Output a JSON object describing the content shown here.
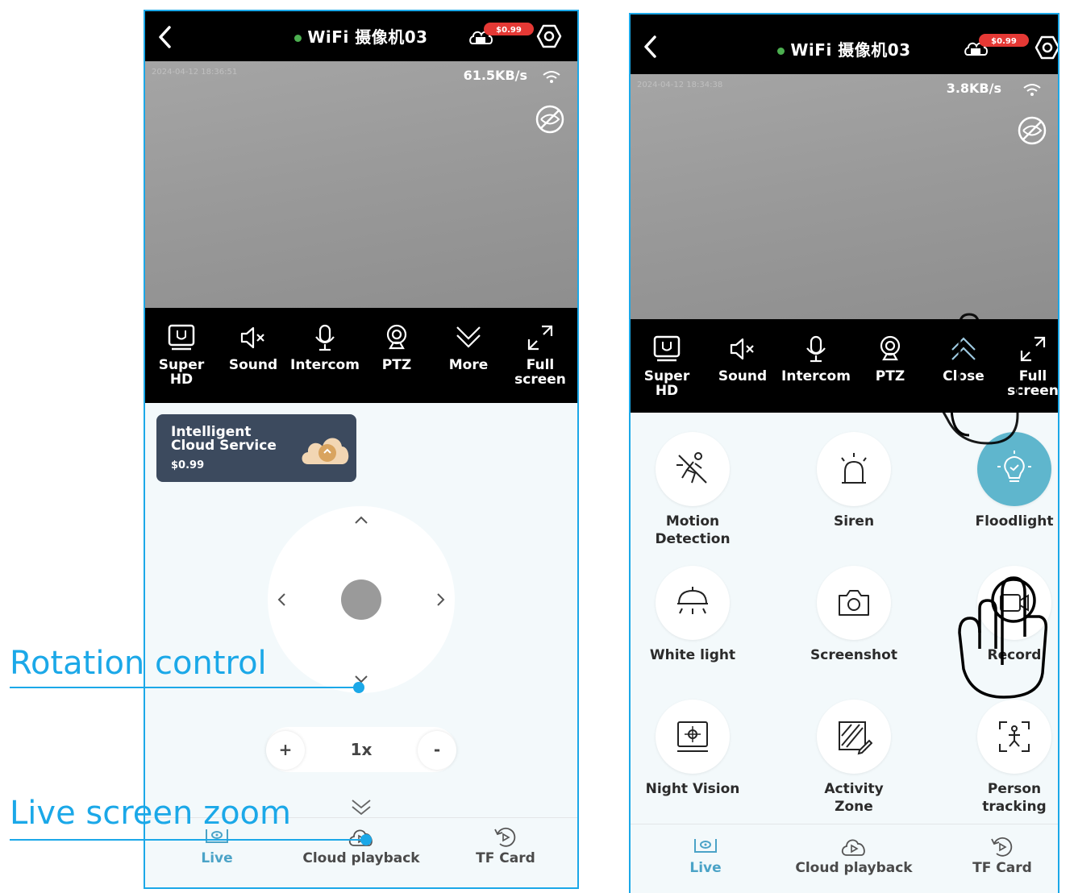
{
  "colors": {
    "accent": "#1ba8e8",
    "online": "#4caf50",
    "price_badge": "#e53935",
    "floodlight_on": "#5fb6cd",
    "nav_active": "#4ba3c7"
  },
  "left": {
    "header": {
      "back_icon": "chevron-left-icon",
      "title": "WiFi 摄像机03",
      "cloud_price": "$0.99"
    },
    "video": {
      "timestamp": "2024-04-12 18:36:51",
      "speed": "61.5KB/s"
    },
    "toolbar": [
      {
        "label": "Super HD",
        "icon": "hd-icon"
      },
      {
        "label": "Sound",
        "icon": "speaker-mute-icon"
      },
      {
        "label": "Intercom",
        "icon": "microphone-icon"
      },
      {
        "label": "PTZ",
        "icon": "camera-icon"
      },
      {
        "label": "More",
        "icon": "chevron-double-down-icon"
      },
      {
        "label": "Full screen",
        "icon": "expand-icon"
      }
    ],
    "promo": {
      "title": "Intelligent Cloud Service",
      "price": "$0.99"
    },
    "zoom": {
      "plus": "+",
      "value": "1x",
      "minus": "-"
    },
    "nav": [
      {
        "label": "Live",
        "icon": "live-icon",
        "active": true
      },
      {
        "label": "Cloud playback",
        "icon": "cloud-play-icon",
        "active": false
      },
      {
        "label": "TF Card",
        "icon": "tf-card-icon",
        "active": false
      }
    ]
  },
  "right": {
    "header": {
      "title": "WiFi 摄像机03",
      "cloud_price": "$0.99"
    },
    "video": {
      "timestamp": "2024-04-12 18:34:38",
      "speed": "3.8KB/s"
    },
    "toolbar": [
      {
        "label": "Super HD",
        "icon": "hd-icon"
      },
      {
        "label": "Sound",
        "icon": "speaker-mute-icon"
      },
      {
        "label": "Intercom",
        "icon": "microphone-icon"
      },
      {
        "label": "PTZ",
        "icon": "camera-icon"
      },
      {
        "label": "Close",
        "icon": "chevron-double-up-icon"
      },
      {
        "label": "Full screen",
        "icon": "expand-icon"
      }
    ],
    "features": [
      {
        "label": "Motion Detection",
        "icon": "motion-detection-icon",
        "on": false
      },
      {
        "label": "Siren",
        "icon": "siren-icon",
        "on": false
      },
      {
        "label": "Floodlight",
        "icon": "floodlight-icon",
        "on": true
      },
      {
        "label": "White light",
        "icon": "white-light-icon",
        "on": false
      },
      {
        "label": "Screenshot",
        "icon": "screenshot-icon",
        "on": false
      },
      {
        "label": "Record",
        "icon": "record-icon",
        "on": false
      },
      {
        "label": "Night Vision",
        "icon": "night-vision-icon",
        "on": false
      },
      {
        "label": "Activity Zone",
        "icon": "activity-zone-icon",
        "on": false
      },
      {
        "label": "Person tracking",
        "icon": "person-tracking-icon",
        "on": false
      }
    ],
    "nav": [
      {
        "label": "Live",
        "icon": "live-icon",
        "active": true
      },
      {
        "label": "Cloud playback",
        "icon": "cloud-play-icon",
        "active": false
      },
      {
        "label": "TF Card",
        "icon": "tf-card-icon",
        "active": false
      }
    ]
  },
  "annotations": {
    "rotation": "Rotation control",
    "zoom": "Live screen zoom"
  }
}
